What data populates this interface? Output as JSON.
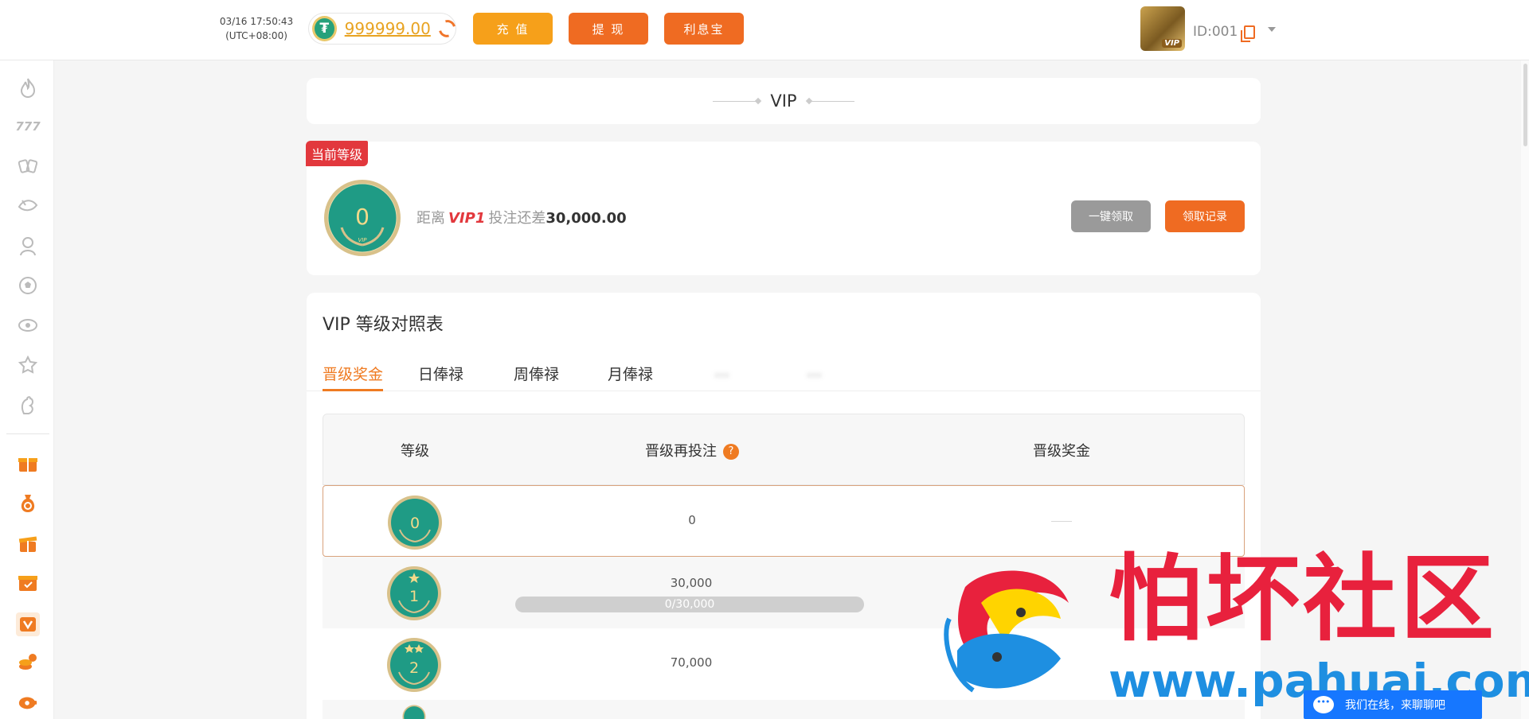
{
  "header": {
    "datetime": "03/16 17:50:43",
    "timezone": "(UTC+08:00)",
    "balance": "999999.00",
    "currency_icon": "tether-icon",
    "deposit_label": "充 值",
    "withdraw_label": "提 现",
    "interest_label": "利息宝",
    "user_id": "ID:001",
    "avatar_badge": "VIP"
  },
  "sidebar": {
    "icons": [
      "flame-icon",
      "slot-777-icon",
      "cards-icon",
      "fish-icon",
      "live-dealer-icon",
      "soccer-ball-icon",
      "lottery-icon",
      "cockfight-icon",
      "rooster-icon",
      "gift-box-icon",
      "money-bag-icon",
      "gift-open-icon",
      "task-box-icon",
      "vip-badge-icon",
      "coins-icon",
      "piggy-bank-icon"
    ]
  },
  "page": {
    "title": "VIP",
    "current_level_ribbon": "当前等级",
    "current_level": "0",
    "distance_prefix": "距离",
    "next_vip": "VIP1",
    "bet_shortfall_label": "投注还差",
    "bet_shortfall_amount": "30,000.00",
    "claim_all_label": "一键领取",
    "records_label": "领取记录"
  },
  "table": {
    "title": "VIP 等级对照表",
    "tabs": [
      "晋级奖金",
      "日俸禄",
      "周俸禄",
      "月俸禄",
      "…",
      "…"
    ],
    "headers": {
      "level": "等级",
      "upgrade_bet": "晋级再投注",
      "upgrade_bonus": "晋级奖金"
    },
    "rows": [
      {
        "level": "0",
        "bet": "0",
        "bonus": "—"
      },
      {
        "level": "1",
        "bet": "30,000",
        "progress": "0/30,000"
      },
      {
        "level": "2",
        "bet": "70,000"
      }
    ]
  },
  "watermark": {
    "text": "怕坏社区",
    "url": "www.pahuai.com"
  },
  "chat": {
    "label": "我们在线，来聊聊吧"
  },
  "colors": {
    "accent_orange": "#ef6b22",
    "deposit_yellow": "#f6a01a",
    "ribbon_red": "#e2383d",
    "medal_green": "#1f9b85",
    "medal_gold": "#d8c18a"
  }
}
